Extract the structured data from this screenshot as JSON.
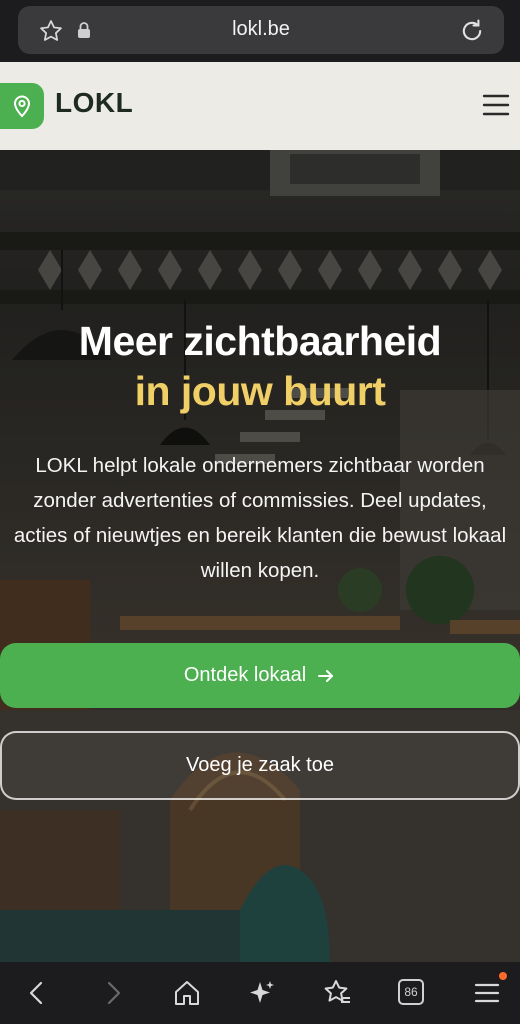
{
  "browser": {
    "url": "lokl.be",
    "tab_count": "86",
    "icons": [
      "star-outline-icon",
      "lock-icon",
      "reload-icon",
      "back-icon",
      "forward-icon",
      "home-icon",
      "sparkle-icon",
      "favorites-icon",
      "tabs-icon",
      "menu-icon"
    ]
  },
  "site": {
    "brand": "LOKL",
    "logo_icon": "map-pin-icon",
    "menu_icon": "hamburger-icon",
    "accent_color": "#4caf50",
    "highlight_color": "#f0cf67"
  },
  "hero": {
    "title_line1": "Meer zichtbaarheid",
    "title_line2": "in jouw buurt",
    "description": "LOKL helpt lokale ondernemers zichtbaar worden zonder advertenties of commissies. Deel updates, acties of nieuwtjes en bereik klanten die bewust lokaal willen kopen.",
    "primary_cta": "Ontdek lokaal",
    "primary_cta_icon": "arrow-right-icon",
    "secondary_cta": "Voeg je zaak toe"
  }
}
